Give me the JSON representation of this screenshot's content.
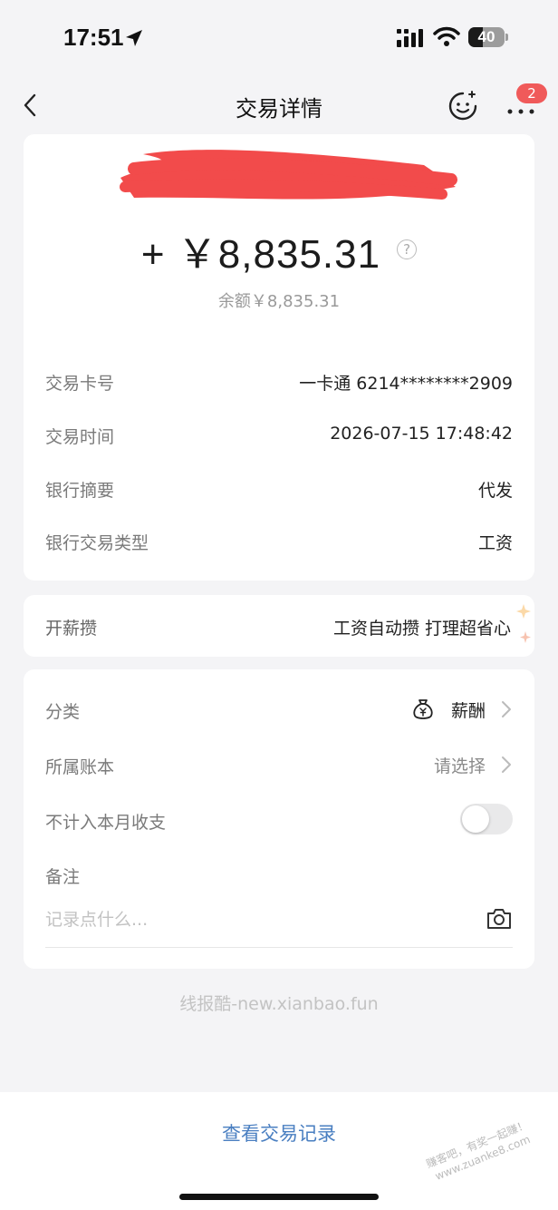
{
  "status_bar": {
    "time": "17:51",
    "battery_level": "40",
    "battery_fraction": 0.4,
    "icons": [
      "location-arrow-icon",
      "signal-icon",
      "wifi-icon",
      "battery-icon"
    ]
  },
  "nav": {
    "title": "交易详情",
    "badge_count": "2",
    "icons": [
      "chevron-left-icon",
      "robot-icon",
      "more-icon"
    ]
  },
  "summary": {
    "amount": "+ ￥8,835.31",
    "balance": "余额￥8,835.31",
    "rows": [
      {
        "label": "交易卡号",
        "value": "一卡通 6214********2909"
      },
      {
        "label": "交易时间",
        "value": "2026-07-15 17:48:42"
      },
      {
        "label": "银行摘要",
        "value": "代发"
      },
      {
        "label": "银行交易类型",
        "value": "工资"
      }
    ]
  },
  "salary": {
    "label": "开薪攒",
    "promo": "工资自动攒 打理超省心"
  },
  "settings": {
    "category_label": "分类",
    "category_value": "薪酬",
    "ledger_label": "所属账本",
    "ledger_value": "请选择",
    "exclude_label": "不计入本月收支",
    "exclude_on": false,
    "note_label": "备注",
    "note_placeholder": "记录点什么..."
  },
  "watermark": "线报酷-new.xianbao.fun",
  "bottom": {
    "view_records": "查看交易记录",
    "corner_stamp_lines": [
      "赚客吧，有奖一起赚！",
      "www.zuanke8.com"
    ]
  },
  "colors": {
    "accent": "#4a7fc1",
    "badge": "#f05a5a",
    "redaction": "#f24b4b",
    "background": "#f4f4f6"
  }
}
